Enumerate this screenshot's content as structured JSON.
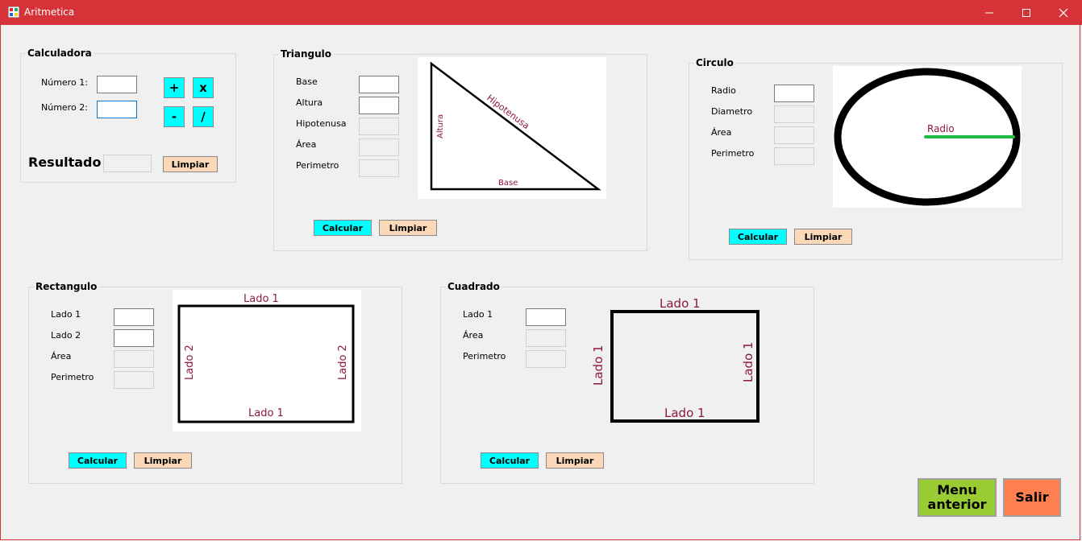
{
  "window": {
    "title": "Aritmetica"
  },
  "calculadora": {
    "title": "Calculadora",
    "numero1_label": "Número 1:",
    "numero2_label": "Número 2:",
    "plus": "+",
    "times": "x",
    "minus": "-",
    "divide": "/",
    "resultado_label": "Resultado",
    "limpiar": "Limpiar"
  },
  "triangulo": {
    "title": "Triangulo",
    "base": "Base",
    "altura": "Altura",
    "hipotenusa": "Hipotenusa",
    "area": "Área",
    "perimetro": "Perimetro",
    "calcular": "Calcular",
    "limpiar": "Limpiar",
    "img_hipotenusa": "Hipotenusa",
    "img_altura": "Altura",
    "img_base": "Base"
  },
  "circulo": {
    "title": "Circulo",
    "radio": "Radio",
    "diametro": "Diametro",
    "area": "Área",
    "perimetro": "Perimetro",
    "calcular": "Calcular",
    "limpiar": "Limpiar",
    "img_radio": "Radio"
  },
  "rectangulo": {
    "title": "Rectangulo",
    "lado1": "Lado 1",
    "lado2": "Lado 2",
    "area": "Área",
    "perimetro": "Perimetro",
    "calcular": "Calcular",
    "limpiar": "Limpiar",
    "img_lado1": "Lado 1",
    "img_lado2": "Lado 2"
  },
  "cuadrado": {
    "title": "Cuadrado",
    "lado1": "Lado 1",
    "area": "Área",
    "perimetro": "Perimetro",
    "calcular": "Calcular",
    "limpiar": "Limpiar",
    "img_lado1": "Lado 1"
  },
  "footer": {
    "menu_line1": "Menu",
    "menu_line2": "anterior",
    "salir": "Salir"
  },
  "colors": {
    "titlebar": "#d63339",
    "op_button": "#00ffff",
    "limpiar_button": "#fbd8b8",
    "menu_button": "#99cc33",
    "salir_button": "#ff7f50",
    "radio_line": "#22bb44",
    "label_text": "#8b1a3a"
  },
  "icons": [
    "app-icon",
    "minimize-icon",
    "maximize-icon",
    "close-icon"
  ]
}
